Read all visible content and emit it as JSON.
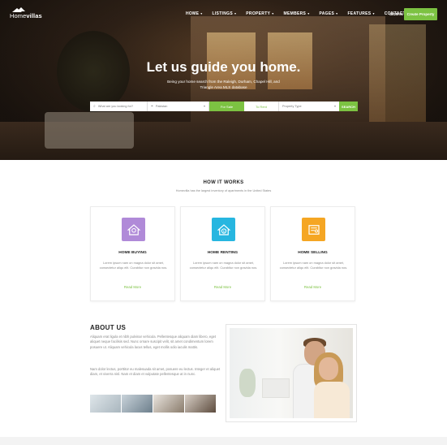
{
  "nav": {
    "logo_light": "Home",
    "logo_bold": "villas",
    "items": [
      {
        "label": "HOME",
        "caret": true
      },
      {
        "label": "LISTINGS",
        "caret": true
      },
      {
        "label": "PROPERTY",
        "caret": true
      },
      {
        "label": "MEMBERS",
        "caret": true
      },
      {
        "label": "PAGES",
        "caret": true
      },
      {
        "label": "FEATURES",
        "caret": true
      },
      {
        "label": "CONTACT",
        "caret": false
      }
    ],
    "signin": "SIGN IN",
    "create": "Create Property"
  },
  "hero": {
    "title": "Let us guide you home.",
    "subtitle": "Being your home search from the Raleigh, Durham, Chapel Hill, and Triangle Area MLS database"
  },
  "search": {
    "keyword_placeholder": "What are you looking for?",
    "location_value": "Pakistan",
    "sale_tab": "For Sale",
    "rent_tab": "To Rent",
    "type_value": "Property Type",
    "button": "SEARCH"
  },
  "how": {
    "title": "HOW IT WORKS",
    "subtitle": "Homevilla has the largest inventory of apartments in the United States",
    "cards": [
      {
        "title": "HOME BUYING",
        "desc": "Lorem ipsum nam on magna dolor sit amet, consectetur aliqu elit. Curabitur non gravida nos.",
        "link": "Read More",
        "color": "#b08ad8"
      },
      {
        "title": "HOME RENTING",
        "desc": "Lorem ipsum nam on magna dolor sit amet, consectetur aliqu elit. Curabitur non gravida nos.",
        "link": "Read More",
        "color": "#27b6e0"
      },
      {
        "title": "HOME SELLING",
        "desc": "Lorem ipsum nam on magna dolor sit amet, consectetur aliqu elit. Curabitur non gravida nos.",
        "link": "Read More",
        "color": "#f5a623"
      }
    ]
  },
  "about": {
    "title": "ABOUT US",
    "p1": "Aliquam erat ligula et nibh pulvinar vehicula. Pellentesque aliquam diam libero, eget aliquet neque facilisis sed. Nunc ornare suscipit velit, sit amet condimentum lorem posuere ut. Aliquam vehicula lacus tellus, eget mollis odio iaculis mattis.",
    "p2": "Nam dolor lectus, porttitor eu malesuada sit amet, posuere eu lectus. Integer et aliquet diam, et viverra nisl. Nam et diam et vulputate pellentesque at in nunc."
  }
}
